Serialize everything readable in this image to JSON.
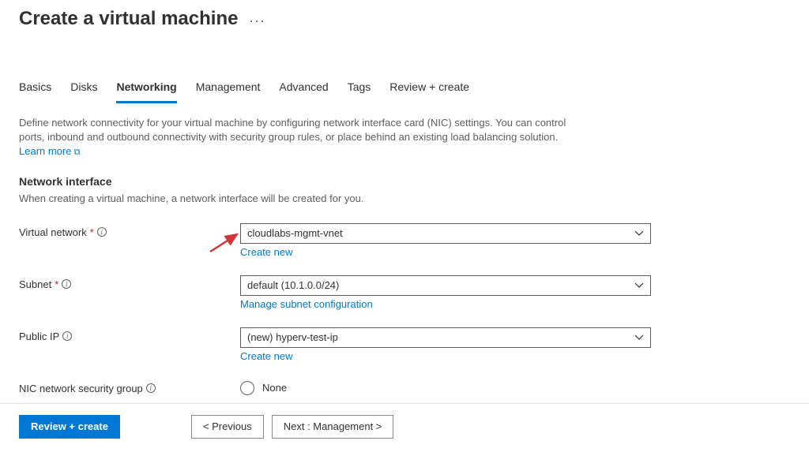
{
  "header": {
    "title": "Create a virtual machine",
    "more": "..."
  },
  "tabs": [
    "Basics",
    "Disks",
    "Networking",
    "Management",
    "Advanced",
    "Tags",
    "Review + create"
  ],
  "description": "Define network connectivity for your virtual machine by configuring network interface card (NIC) settings. You can control ports, inbound and outbound connectivity with security group rules, or place behind an existing load balancing solution.",
  "learn_more": "Learn more",
  "section": {
    "title": "Network interface",
    "desc": "When creating a virtual machine, a network interface will be created for you."
  },
  "fields": {
    "vnet": {
      "label": "Virtual network",
      "value": "cloudlabs-mgmt-vnet",
      "sublink": "Create new"
    },
    "subnet": {
      "label": "Subnet",
      "value": "default (10.1.0.0/24)",
      "sublink": "Manage subnet configuration"
    },
    "publicip": {
      "label": "Public IP",
      "value": "(new) hyperv-test-ip",
      "sublink": "Create new"
    },
    "nsg": {
      "label": "NIC network security group",
      "option_none": "None"
    }
  },
  "footer": {
    "review": "Review + create",
    "previous": "< Previous",
    "next": "Next : Management >"
  }
}
